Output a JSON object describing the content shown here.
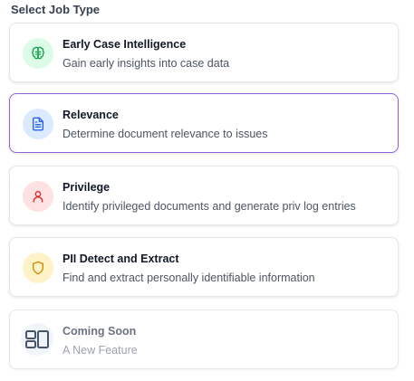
{
  "section_title": "Select Job Type",
  "job_types": [
    {
      "title": "Early Case Intelligence",
      "description": "Gain early insights into case data",
      "icon": "brain-icon",
      "icon_color": "#16a34a",
      "icon_bg": "#dcfce7",
      "selected": false,
      "disabled": false
    },
    {
      "title": "Relevance",
      "description": "Determine document relevance to issues",
      "icon": "document-icon",
      "icon_color": "#2563eb",
      "icon_bg": "#dbeafe",
      "selected": true,
      "disabled": false
    },
    {
      "title": "Privilege",
      "description": "Identify privileged documents and generate priv log entries",
      "icon": "user-icon",
      "icon_color": "#dc2626",
      "icon_bg": "#fee2e2",
      "selected": false,
      "disabled": false
    },
    {
      "title": "PII Detect and Extract",
      "description": "Find and extract personally identifiable information",
      "icon": "shield-icon",
      "icon_color": "#ca8a04",
      "icon_bg": "#fef3c7",
      "selected": false,
      "disabled": false
    },
    {
      "title": "Coming Soon",
      "description": "A New Feature",
      "icon": "layout-icon",
      "icon_color": "#475569",
      "icon_bg": "#f1f5f9",
      "selected": false,
      "disabled": true
    }
  ],
  "colors": {
    "selected_border": "#9061d8"
  }
}
